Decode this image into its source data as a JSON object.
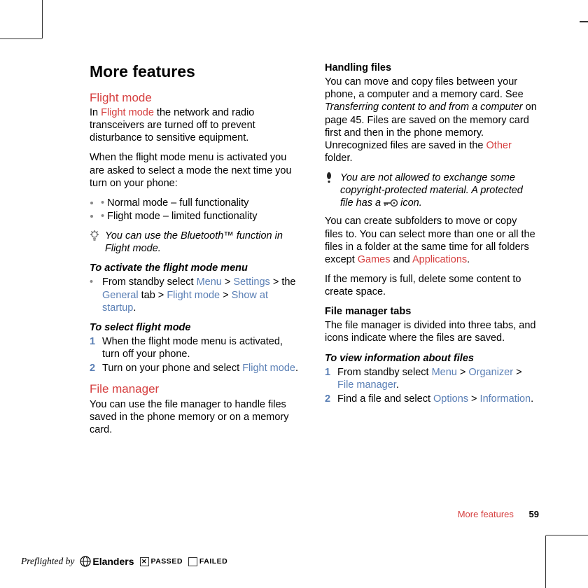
{
  "header": {
    "title": "More features"
  },
  "left": {
    "flight_mode": {
      "heading": "Flight mode",
      "intro_pre": "In ",
      "intro_link": "Flight mode",
      "intro_post": " the network and radio transceivers are turned off to prevent disturbance to sensitive equipment.",
      "para2": "When the flight mode menu is activated you are asked to select a mode the next time you turn on your phone:",
      "bullets": [
        {
          "link": "Normal mode",
          "text": " – full functionality"
        },
        {
          "link": "Flight mode",
          "text": " – limited functionality"
        }
      ],
      "tip": "You can use the Bluetooth™ function in Flight mode.",
      "activate_head": "To activate the flight mode menu",
      "activate_step": {
        "pre": "From standby select ",
        "l1": "Menu",
        "gt1": " > ",
        "l2": "Settings",
        "gt2": " > the ",
        "l3": "General",
        "mid": " tab > ",
        "l4": "Flight mode",
        "gt3": " > ",
        "l5": "Show at startup",
        "end": "."
      },
      "select_head": "To select flight mode",
      "select_steps": [
        {
          "n": "1",
          "text": "When the flight mode menu is activated, turn off your phone."
        },
        {
          "n": "2",
          "pre": "Turn on your phone and select ",
          "link": "Flight mode",
          "end": "."
        }
      ]
    },
    "file_manager": {
      "heading": "File manager",
      "intro": "You can use the file manager to handle files saved in the phone memory or on a memory card."
    }
  },
  "right": {
    "handling": {
      "heading": "Handling files",
      "p1_pre": "You can move and copy files between your phone, a computer and a memory card. See ",
      "p1_ital": "Transferring content to and from a computer",
      "p1_mid": " on page 45. Files are saved on the memory card first and then in the phone memory. Unrecognized files are saved in the ",
      "p1_link": "Other",
      "p1_end": " folder.",
      "warn_l1": "You are not allowed to exchange some copyright-protected material. A protected file has a ",
      "warn_l2": " icon.",
      "p2_pre": "You can create subfolders to move or copy files to. You can select more than one or all the files in a folder at the same time for all folders except ",
      "p2_l1": "Games",
      "p2_and": " and ",
      "p2_l2": "Applications",
      "p2_end": ".",
      "p3": "If the memory is full, delete some content to create space."
    },
    "tabs": {
      "heading": "File manager tabs",
      "p": "The file manager is divided into three tabs, and icons indicate where the files are saved."
    },
    "view": {
      "heading": "To view information about files",
      "steps": [
        {
          "n": "1",
          "pre": "From standby select ",
          "l1": "Menu",
          "gt1": " > ",
          "l2": "Organizer",
          "gt2": " > ",
          "l3": "File manager",
          "end": "."
        },
        {
          "n": "2",
          "pre": "Find a file and select ",
          "l1": "Options",
          "gt1": " > ",
          "l2": "Information",
          "end": "."
        }
      ]
    }
  },
  "footer": {
    "section": "More features",
    "page": "59"
  },
  "preflight": {
    "by": "Preflighted by",
    "brand": "Elanders",
    "passed": "PASSED",
    "failed": "FAILED"
  }
}
